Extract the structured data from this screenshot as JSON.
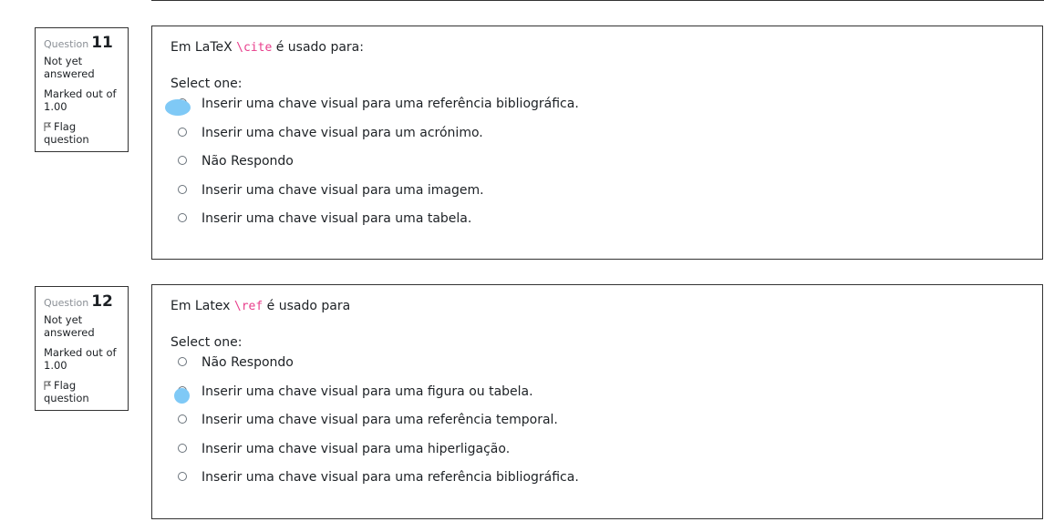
{
  "questions": [
    {
      "label": "Question",
      "number": "11",
      "state": "Not yet answered",
      "grade": "Marked out of 1.00",
      "flag_label": "Flag question",
      "text_before": "Em LaTeX ",
      "text_code": "\\cite",
      "text_after": " é usado para:",
      "prompt": "Select one:",
      "options": [
        "Inserir uma chave visual para uma referência bibliográfica.",
        "Inserir uma chave visual para um acrónimo.",
        "Não Respondo",
        "Inserir uma chave visual para uma imagem.",
        "Inserir uma chave visual para uma tabela."
      ]
    },
    {
      "label": "Question",
      "number": "12",
      "state": "Not yet answered",
      "grade": "Marked out of 1.00",
      "flag_label": "Flag question",
      "text_before": "Em Latex ",
      "text_code": "\\ref",
      "text_after": " é usado para",
      "prompt": "Select one:",
      "options": [
        "Não Respondo",
        "Inserir uma chave visual para uma figura ou tabela.",
        "Inserir uma chave visual para uma referência temporal.",
        "Inserir uma chave visual para uma hiperligação.",
        "Inserir uma chave visual para uma referência bibliográfica."
      ]
    }
  ],
  "colors": {
    "code": "#e83e8c",
    "highlight_mark": "#7fc9f6",
    "border": "#333333"
  }
}
